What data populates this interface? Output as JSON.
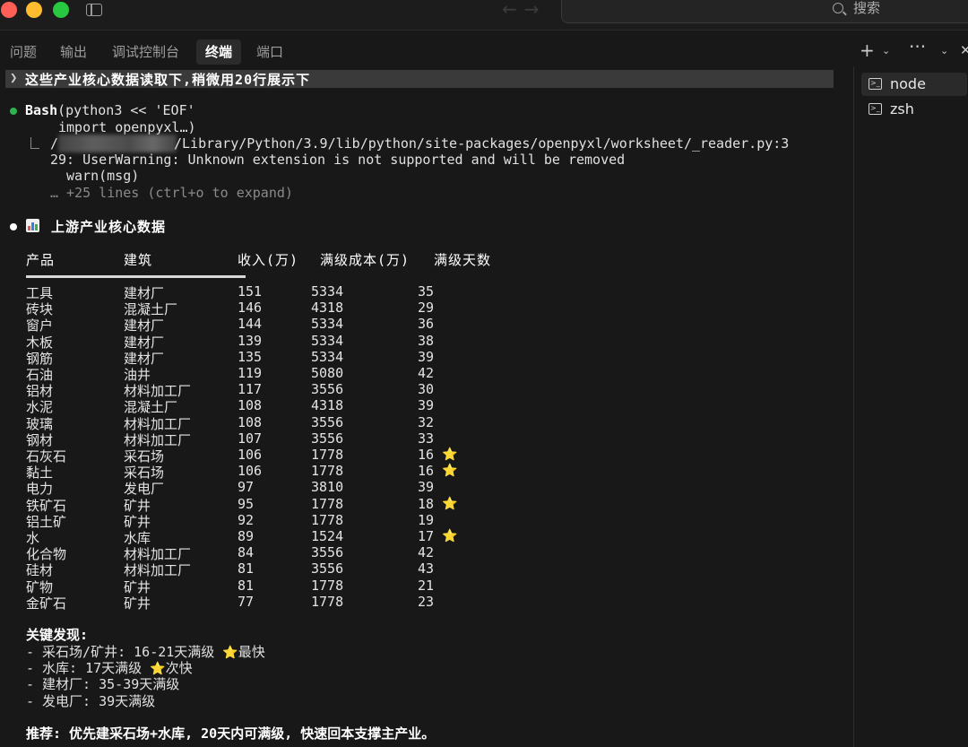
{
  "titlebar": {
    "search_label": "搜索"
  },
  "panel_tabs": [
    {
      "label": "问题",
      "active": false
    },
    {
      "label": "输出",
      "active": false
    },
    {
      "label": "调试控制台",
      "active": false
    },
    {
      "label": "终端",
      "active": true
    },
    {
      "label": "端口",
      "active": false
    }
  ],
  "panel_actions": {
    "add": "+",
    "add_dropdown": "⌄",
    "more": "···",
    "collapse": "⌄",
    "close": "✕"
  },
  "sessions": [
    {
      "name": "node",
      "icon": "terminal-icon",
      "active": true
    },
    {
      "name": "zsh",
      "icon": "terminal-icon",
      "active": false
    }
  ],
  "terminal": {
    "prompt": "这些产业核心数据读取下,稍微用20行展示下",
    "bash_tool": "Bash",
    "bash_cmd": "(python3 << 'EOF'",
    "bash_cmd2": "import openpyxl…)",
    "out1_prefix": "/",
    "out1_path": "/Library/Python/3.9/lib/python/site-packages/openpyxl/worksheet/_reader.py:3",
    "out2": "29: UserWarning: Unknown extension is not supported and will be removed",
    "out3": "warn(msg)",
    "out4": "… +25 lines (ctrl+o to expand)",
    "section_title": "上游产业核心数据",
    "table_headers": [
      "产品",
      "建筑",
      "收入(万)",
      "满级成本(万)",
      "满级天数"
    ],
    "rows": [
      {
        "product": "工具",
        "building": "建材厂",
        "income": "151",
        "cost": "5334",
        "days": "35",
        "star": ""
      },
      {
        "product": "砖块",
        "building": "混凝土厂",
        "income": "146",
        "cost": "4318",
        "days": "29",
        "star": ""
      },
      {
        "product": "窗户",
        "building": "建材厂",
        "income": "144",
        "cost": "5334",
        "days": "36",
        "star": ""
      },
      {
        "product": "木板",
        "building": "建材厂",
        "income": "139",
        "cost": "5334",
        "days": "38",
        "star": ""
      },
      {
        "product": "钢筋",
        "building": "建材厂",
        "income": "135",
        "cost": "5334",
        "days": "39",
        "star": ""
      },
      {
        "product": "石油",
        "building": "油井",
        "income": "119",
        "cost": "5080",
        "days": "42",
        "star": ""
      },
      {
        "product": "铝材",
        "building": "材料加工厂",
        "income": "117",
        "cost": "3556",
        "days": "30",
        "star": ""
      },
      {
        "product": "水泥",
        "building": "混凝土厂",
        "income": "108",
        "cost": "4318",
        "days": "39",
        "star": ""
      },
      {
        "product": "玻璃",
        "building": "材料加工厂",
        "income": "108",
        "cost": "3556",
        "days": "32",
        "star": ""
      },
      {
        "product": "钢材",
        "building": "材料加工厂",
        "income": "107",
        "cost": "3556",
        "days": "33",
        "star": ""
      },
      {
        "product": "石灰石",
        "building": "采石场",
        "income": "106",
        "cost": "1778",
        "days": "16",
        "star": "⭐"
      },
      {
        "product": "黏土",
        "building": "采石场",
        "income": "106",
        "cost": "1778",
        "days": "16",
        "star": "⭐"
      },
      {
        "product": "电力",
        "building": "发电厂",
        "income": "97",
        "cost": "3810",
        "days": "39",
        "star": ""
      },
      {
        "product": "铁矿石",
        "building": "矿井",
        "income": "95",
        "cost": "1778",
        "days": "18",
        "star": "⭐"
      },
      {
        "product": "铝土矿",
        "building": "矿井",
        "income": "92",
        "cost": "1778",
        "days": "19",
        "star": ""
      },
      {
        "product": "水",
        "building": "水库",
        "income": "89",
        "cost": "1524",
        "days": "17",
        "star": "⭐"
      },
      {
        "product": "化合物",
        "building": "材料加工厂",
        "income": "84",
        "cost": "3556",
        "days": "42",
        "star": ""
      },
      {
        "product": "硅材",
        "building": "材料加工厂",
        "income": "81",
        "cost": "3556",
        "days": "43",
        "star": ""
      },
      {
        "product": "矿物",
        "building": "矿井",
        "income": "81",
        "cost": "1778",
        "days": "21",
        "star": ""
      },
      {
        "product": "金矿石",
        "building": "矿井",
        "income": "77",
        "cost": "1778",
        "days": "23",
        "star": ""
      }
    ],
    "findings_title": "关键发现:",
    "findings": [
      {
        "text": "- 采石场/矿井: 16-21天满级 ",
        "star": "⭐",
        "suffix": "最快"
      },
      {
        "text": "- 水库: 17天满级 ",
        "star": "⭐",
        "suffix": "次快"
      },
      {
        "text": "- 建材厂: 35-39天满级",
        "star": "",
        "suffix": ""
      },
      {
        "text": "- 发电厂: 39天满级",
        "star": "",
        "suffix": ""
      }
    ],
    "recommendation": "推荐: 优先建采石场+水库, 20天内可满级, 快速回本支撑主产业。"
  },
  "colors": {
    "background": "#181818",
    "green_dot": "#2fb34e",
    "star": "#f5c542",
    "traffic_red": "#fe5f57",
    "traffic_yellow": "#febc2e",
    "traffic_green": "#28c840"
  }
}
